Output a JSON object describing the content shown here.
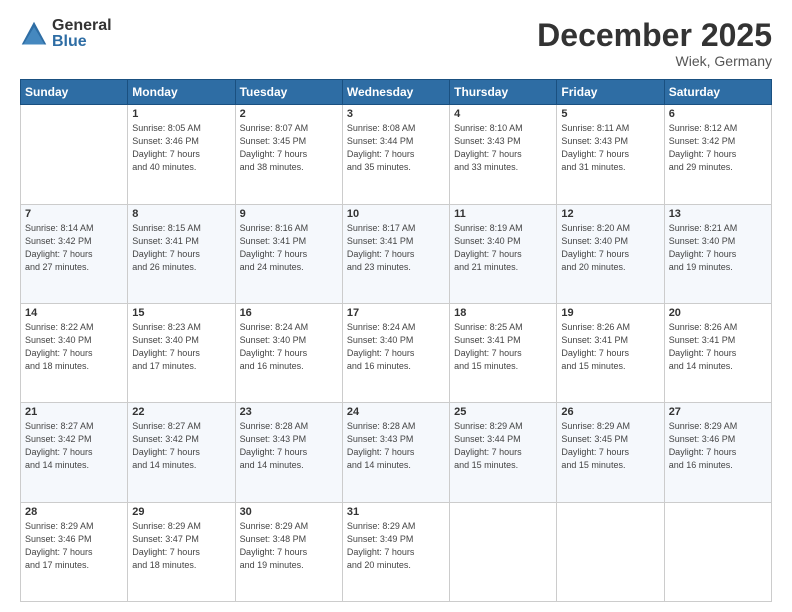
{
  "logo": {
    "general": "General",
    "blue": "Blue"
  },
  "header": {
    "month": "December 2025",
    "location": "Wiek, Germany"
  },
  "days_of_week": [
    "Sunday",
    "Monday",
    "Tuesday",
    "Wednesday",
    "Thursday",
    "Friday",
    "Saturday"
  ],
  "weeks": [
    [
      {
        "day": "",
        "info": ""
      },
      {
        "day": "1",
        "info": "Sunrise: 8:05 AM\nSunset: 3:46 PM\nDaylight: 7 hours\nand 40 minutes."
      },
      {
        "day": "2",
        "info": "Sunrise: 8:07 AM\nSunset: 3:45 PM\nDaylight: 7 hours\nand 38 minutes."
      },
      {
        "day": "3",
        "info": "Sunrise: 8:08 AM\nSunset: 3:44 PM\nDaylight: 7 hours\nand 35 minutes."
      },
      {
        "day": "4",
        "info": "Sunrise: 8:10 AM\nSunset: 3:43 PM\nDaylight: 7 hours\nand 33 minutes."
      },
      {
        "day": "5",
        "info": "Sunrise: 8:11 AM\nSunset: 3:43 PM\nDaylight: 7 hours\nand 31 minutes."
      },
      {
        "day": "6",
        "info": "Sunrise: 8:12 AM\nSunset: 3:42 PM\nDaylight: 7 hours\nand 29 minutes."
      }
    ],
    [
      {
        "day": "7",
        "info": "Sunrise: 8:14 AM\nSunset: 3:42 PM\nDaylight: 7 hours\nand 27 minutes."
      },
      {
        "day": "8",
        "info": "Sunrise: 8:15 AM\nSunset: 3:41 PM\nDaylight: 7 hours\nand 26 minutes."
      },
      {
        "day": "9",
        "info": "Sunrise: 8:16 AM\nSunset: 3:41 PM\nDaylight: 7 hours\nand 24 minutes."
      },
      {
        "day": "10",
        "info": "Sunrise: 8:17 AM\nSunset: 3:41 PM\nDaylight: 7 hours\nand 23 minutes."
      },
      {
        "day": "11",
        "info": "Sunrise: 8:19 AM\nSunset: 3:40 PM\nDaylight: 7 hours\nand 21 minutes."
      },
      {
        "day": "12",
        "info": "Sunrise: 8:20 AM\nSunset: 3:40 PM\nDaylight: 7 hours\nand 20 minutes."
      },
      {
        "day": "13",
        "info": "Sunrise: 8:21 AM\nSunset: 3:40 PM\nDaylight: 7 hours\nand 19 minutes."
      }
    ],
    [
      {
        "day": "14",
        "info": "Sunrise: 8:22 AM\nSunset: 3:40 PM\nDaylight: 7 hours\nand 18 minutes."
      },
      {
        "day": "15",
        "info": "Sunrise: 8:23 AM\nSunset: 3:40 PM\nDaylight: 7 hours\nand 17 minutes."
      },
      {
        "day": "16",
        "info": "Sunrise: 8:24 AM\nSunset: 3:40 PM\nDaylight: 7 hours\nand 16 minutes."
      },
      {
        "day": "17",
        "info": "Sunrise: 8:24 AM\nSunset: 3:40 PM\nDaylight: 7 hours\nand 16 minutes."
      },
      {
        "day": "18",
        "info": "Sunrise: 8:25 AM\nSunset: 3:41 PM\nDaylight: 7 hours\nand 15 minutes."
      },
      {
        "day": "19",
        "info": "Sunrise: 8:26 AM\nSunset: 3:41 PM\nDaylight: 7 hours\nand 15 minutes."
      },
      {
        "day": "20",
        "info": "Sunrise: 8:26 AM\nSunset: 3:41 PM\nDaylight: 7 hours\nand 14 minutes."
      }
    ],
    [
      {
        "day": "21",
        "info": "Sunrise: 8:27 AM\nSunset: 3:42 PM\nDaylight: 7 hours\nand 14 minutes."
      },
      {
        "day": "22",
        "info": "Sunrise: 8:27 AM\nSunset: 3:42 PM\nDaylight: 7 hours\nand 14 minutes."
      },
      {
        "day": "23",
        "info": "Sunrise: 8:28 AM\nSunset: 3:43 PM\nDaylight: 7 hours\nand 14 minutes."
      },
      {
        "day": "24",
        "info": "Sunrise: 8:28 AM\nSunset: 3:43 PM\nDaylight: 7 hours\nand 14 minutes."
      },
      {
        "day": "25",
        "info": "Sunrise: 8:29 AM\nSunset: 3:44 PM\nDaylight: 7 hours\nand 15 minutes."
      },
      {
        "day": "26",
        "info": "Sunrise: 8:29 AM\nSunset: 3:45 PM\nDaylight: 7 hours\nand 15 minutes."
      },
      {
        "day": "27",
        "info": "Sunrise: 8:29 AM\nSunset: 3:46 PM\nDaylight: 7 hours\nand 16 minutes."
      }
    ],
    [
      {
        "day": "28",
        "info": "Sunrise: 8:29 AM\nSunset: 3:46 PM\nDaylight: 7 hours\nand 17 minutes."
      },
      {
        "day": "29",
        "info": "Sunrise: 8:29 AM\nSunset: 3:47 PM\nDaylight: 7 hours\nand 18 minutes."
      },
      {
        "day": "30",
        "info": "Sunrise: 8:29 AM\nSunset: 3:48 PM\nDaylight: 7 hours\nand 19 minutes."
      },
      {
        "day": "31",
        "info": "Sunrise: 8:29 AM\nSunset: 3:49 PM\nDaylight: 7 hours\nand 20 minutes."
      },
      {
        "day": "",
        "info": ""
      },
      {
        "day": "",
        "info": ""
      },
      {
        "day": "",
        "info": ""
      }
    ]
  ]
}
